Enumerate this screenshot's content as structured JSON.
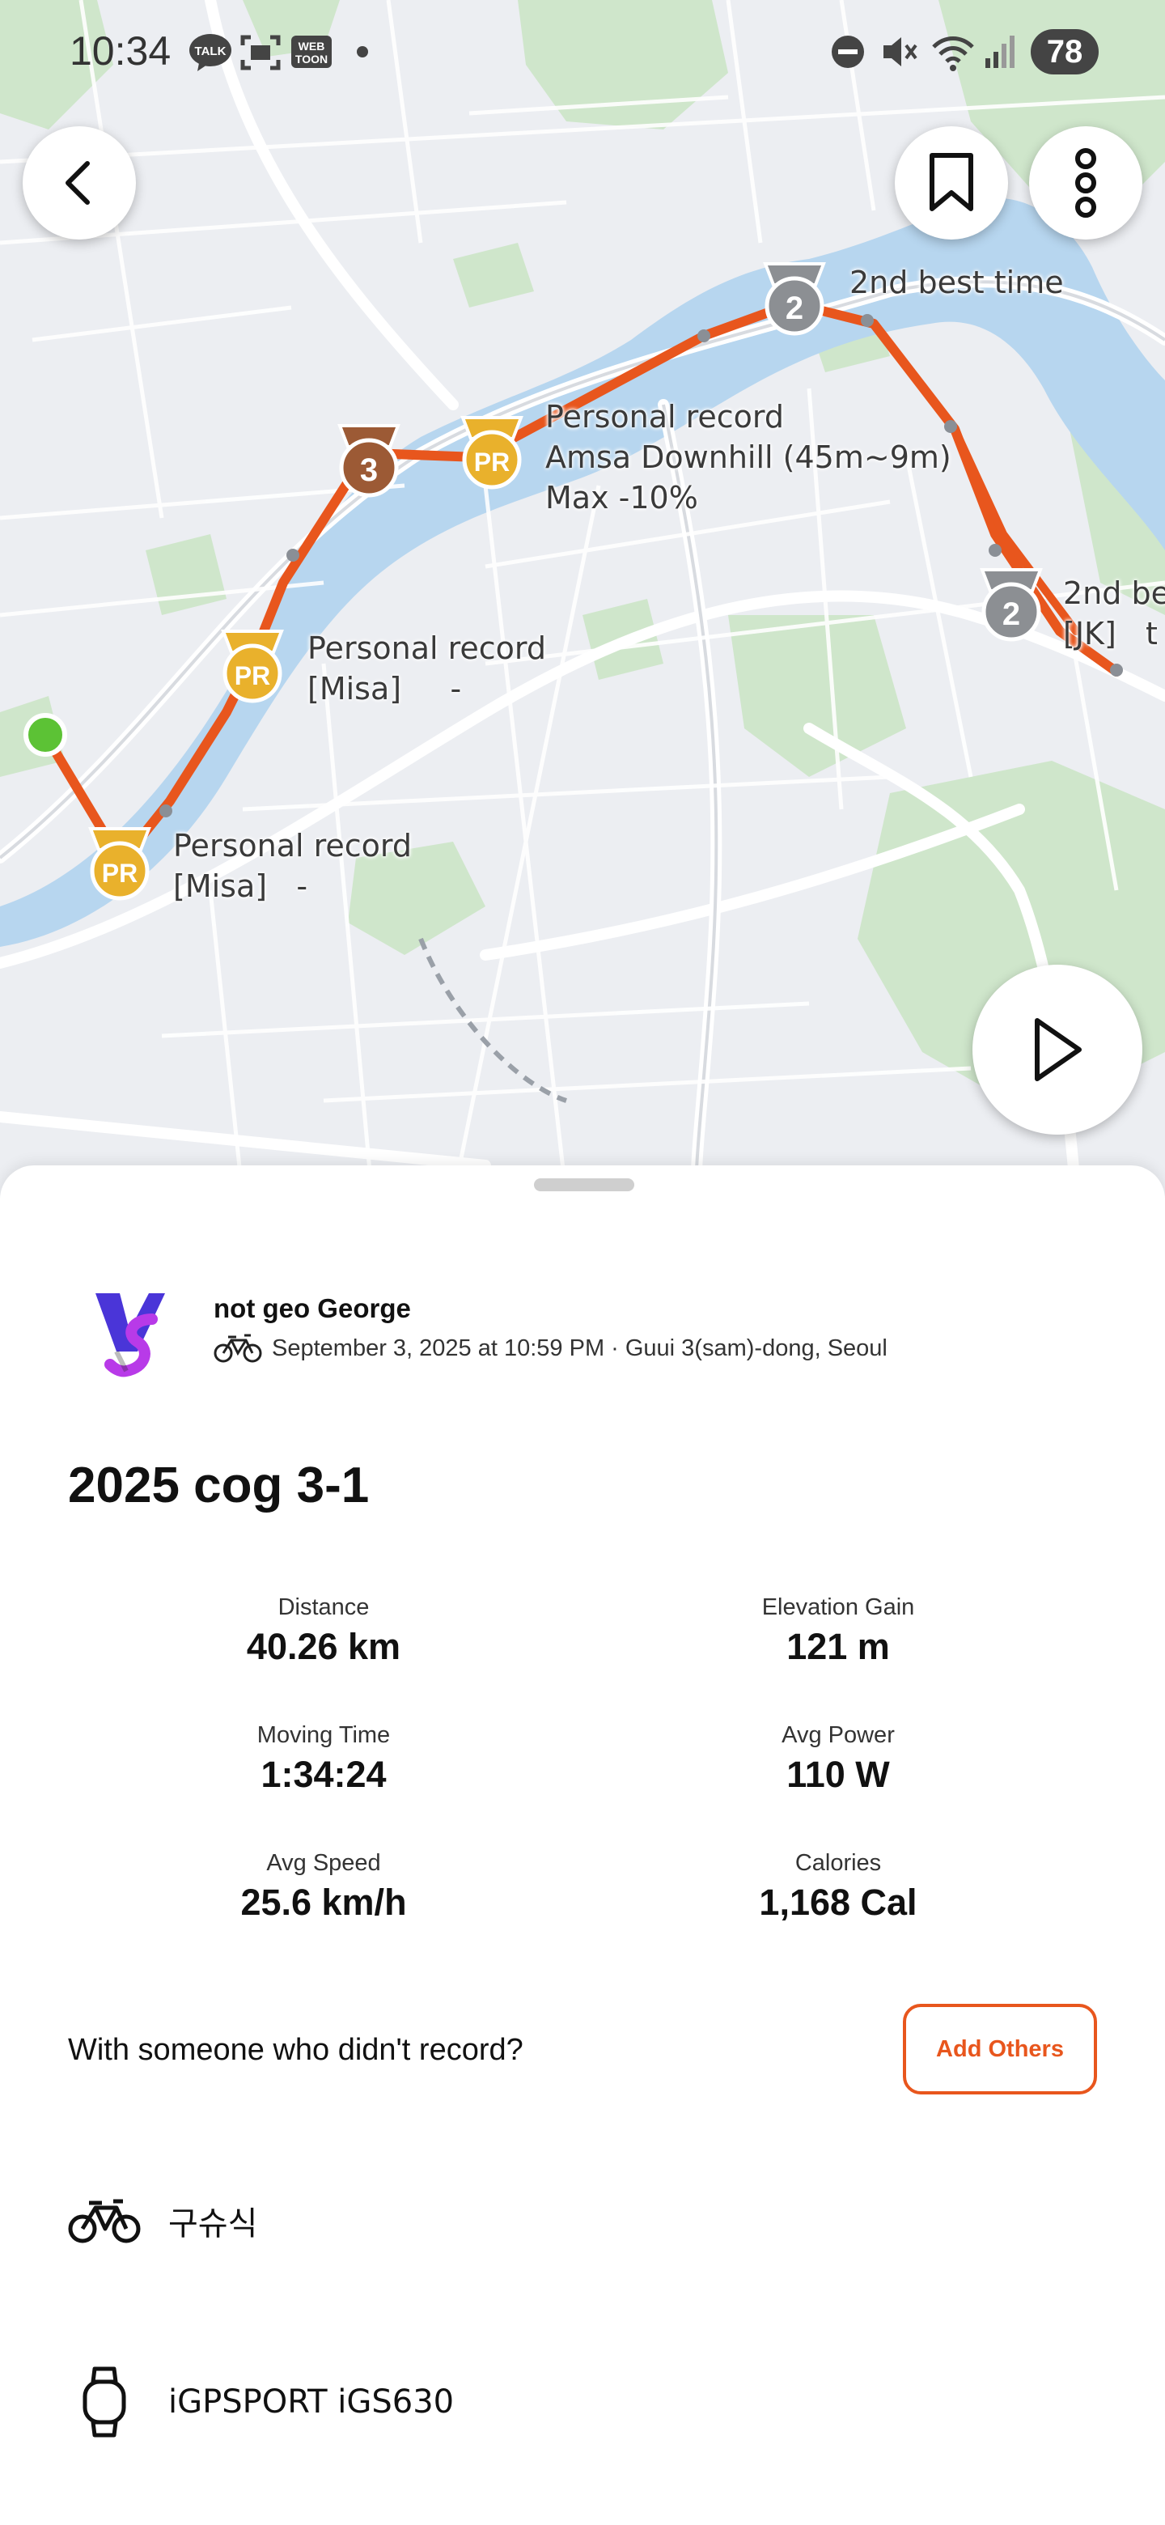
{
  "status_bar": {
    "time": "10:34",
    "battery": "78",
    "app_icons": [
      "talk-icon",
      "screenshot-icon",
      "webtoon-icon"
    ],
    "webtoon_label": "WEB\nTOON",
    "talk_label": "TALK"
  },
  "map": {
    "labels": {
      "second_best_a": "2nd best time",
      "pr_amsa": "Personal record\nAmsa Downhill (45m~9m)\nMax -10%",
      "pr_misa_1": "Personal record\n[Misa]     -",
      "pr_misa_2": "Personal record\n[Misa]   -",
      "second_best_b": "2nd be\n[JK]   t"
    },
    "medals": {
      "pr": "PR",
      "third": "3",
      "second": "2"
    },
    "route_color": "#e8561d"
  },
  "activity": {
    "athlete_name": "not geo George",
    "meta": "September 3, 2025 at 10:59 PM · Guui 3(sam)-dong, Seoul",
    "title": "2025 cog 3-1",
    "stats": [
      {
        "label": "Distance",
        "value": "40.26 km"
      },
      {
        "label": "Elevation Gain",
        "value": "121 m"
      },
      {
        "label": "Moving Time",
        "value": "1:34:24"
      },
      {
        "label": "Avg Power",
        "value": "110 W"
      },
      {
        "label": "Avg Speed",
        "value": "25.6 km/h"
      },
      {
        "label": "Calories",
        "value": "1,168 Cal"
      }
    ],
    "others_prompt": "With someone who didn't record?",
    "add_others_label": "Add Others",
    "bike_name": "구슈식",
    "device_name": "iGPSPORT iGS630"
  },
  "colors": {
    "accent": "#e8561d",
    "water": "#b7d6ef",
    "park": "#c7e3c4",
    "pr_gold": "#e9b12c",
    "bronze": "#9c5a35",
    "silver": "#8c8f93"
  }
}
